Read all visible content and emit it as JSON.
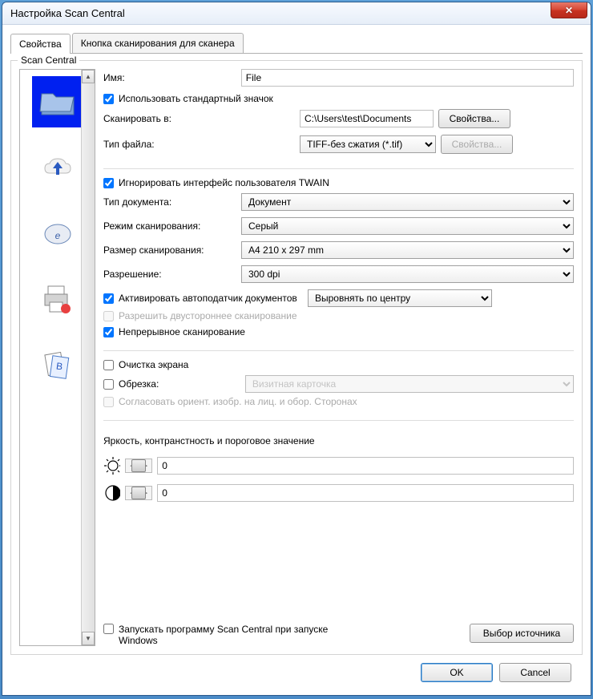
{
  "titlebar": {
    "title": "Настройка Scan Central"
  },
  "tabs": {
    "tab1": "Свойства",
    "tab2": "Кнопка сканирования для сканера"
  },
  "groupbox_title": "Scan Central",
  "labels": {
    "name": "Имя:",
    "use_default_icon": "Использовать стандартный значок",
    "scan_to": "Сканировать в:",
    "file_type": "Тип файла:",
    "ignore_twain": "Игнорировать интерфейс пользователя TWAIN",
    "doc_type": "Тип документа:",
    "scan_mode": "Режим сканирования:",
    "scan_size": "Размер сканирования:",
    "resolution": "Разрешение:",
    "activate_adf": "Активировать автоподатчик документов",
    "duplex": "Разрешить двустороннее сканирование",
    "continuous": "Непрерывное сканирование",
    "screen_cleanup": "Очистка экрана",
    "crop": "Обрезка:",
    "match_orient": "Согласовать ориент. изобр. на лиц. и обор. Сторонах",
    "brightness_section": "Яркость, контранстность и пороговое значение",
    "launch_on_start": "Запускать программу Scan Central при запуске Windows"
  },
  "values": {
    "name": "File",
    "scan_path": "C:\\Users\\test\\Documents",
    "file_type": "TIFF-без сжатия (*.tif)",
    "doc_type": "Документ",
    "scan_mode": "Серый",
    "scan_size": "A4 210 x 297 mm",
    "resolution": "300  dpi",
    "align": "Выровнять по центру",
    "crop": "Визитная карточка",
    "brightness": "0",
    "contrast": "0"
  },
  "buttons": {
    "properties": "Свойства...",
    "properties2": "Свойства...",
    "select_source": "Выбор источника",
    "ok": "OK",
    "cancel": "Cancel"
  }
}
